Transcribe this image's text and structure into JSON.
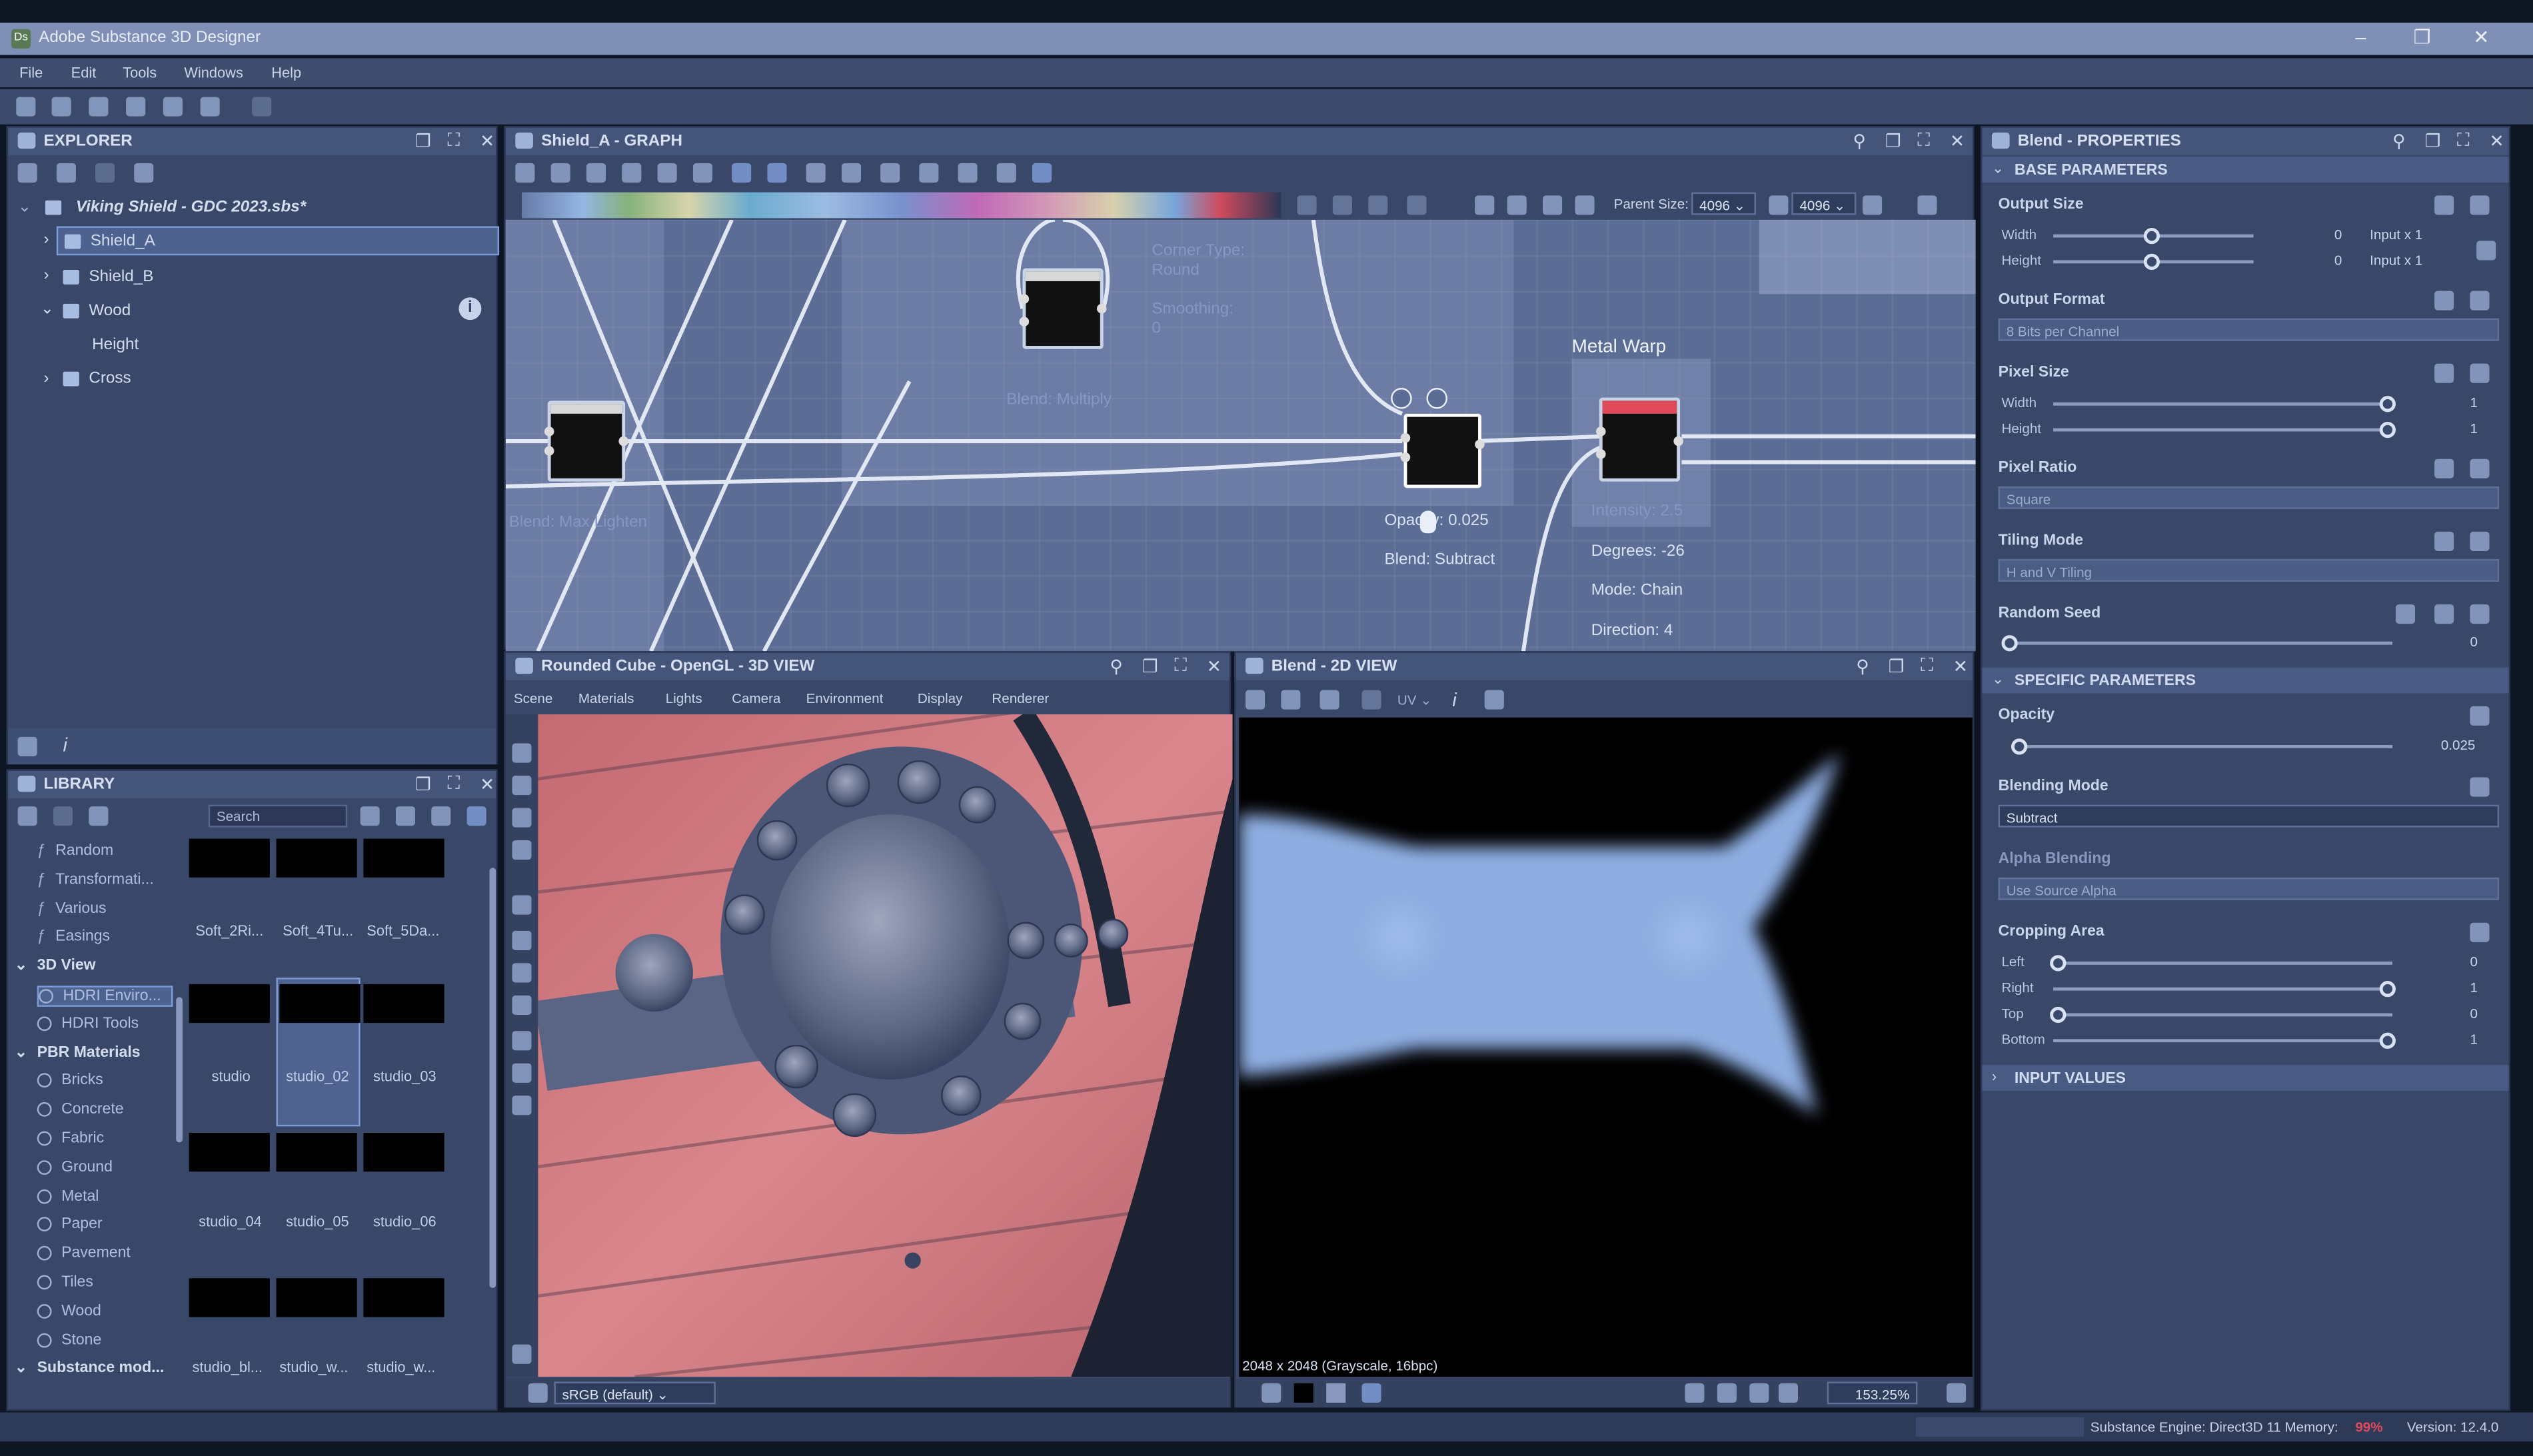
{
  "window": {
    "title": "Adobe Substance 3D Designer",
    "controls": [
      "–",
      "❐",
      "✕"
    ]
  },
  "menu": [
    "File",
    "Edit",
    "Tools",
    "Windows",
    "Help"
  ],
  "explorer": {
    "title": "EXPLORER",
    "package": "Viking Shield - GDC 2023.sbs*",
    "items": [
      "Shield_A",
      "Shield_B",
      "Wood",
      "Height",
      "Cross"
    ]
  },
  "graph": {
    "title": "Shield_A - GRAPH",
    "parent_size_label": "Parent Size:",
    "parent_size": "4096",
    "size2": "4096",
    "nodes": {
      "metal_warp_title": "Metal Warp",
      "corner_type_label": "Corner Type:",
      "corner_type_value": "Round",
      "smoothing_label": "Smoothing:",
      "smoothing_value": "0",
      "blend_multiply": "Blend: Multiply",
      "blend_max_lighten": "Blend: Max Lighten",
      "opacity": "Opacity: 0.025",
      "blend_subtract": "Blend: Subtract",
      "intensity": "Intensity: 2.5",
      "degrees": "Degrees: -26",
      "mode": "Mode: Chain",
      "direction": "Direction: 4"
    }
  },
  "view3d": {
    "title": "Rounded Cube - OpenGL - 3D VIEW",
    "menu": [
      "Scene",
      "Materials",
      "Lights",
      "Camera",
      "Environment",
      "Display",
      "Renderer"
    ],
    "colorspace": "sRGB (default)"
  },
  "view2d": {
    "title": "Blend - 2D VIEW",
    "uv": "UV",
    "info": "2048 x 2048 (Grayscale, 16bpc)",
    "zoom": "153.25%"
  },
  "library": {
    "title": "LIBRARY",
    "search_placeholder": "Search",
    "categories": [
      {
        "label": "Random",
        "type": "fn"
      },
      {
        "label": "Transformati...",
        "type": "fn"
      },
      {
        "label": "Various",
        "type": "fn"
      },
      {
        "label": "Easings",
        "type": "fn"
      },
      {
        "label": "3D View",
        "type": "group"
      },
      {
        "label": "HDRI Enviro...",
        "type": "sel"
      },
      {
        "label": "HDRI Tools",
        "type": "item"
      },
      {
        "label": "PBR Materials",
        "type": "group"
      },
      {
        "label": "Bricks",
        "type": "item"
      },
      {
        "label": "Concrete",
        "type": "item"
      },
      {
        "label": "Fabric",
        "type": "item"
      },
      {
        "label": "Ground",
        "type": "item"
      },
      {
        "label": "Metal",
        "type": "item"
      },
      {
        "label": "Paper",
        "type": "item"
      },
      {
        "label": "Pavement",
        "type": "item"
      },
      {
        "label": "Tiles",
        "type": "item"
      },
      {
        "label": "Wood",
        "type": "item"
      },
      {
        "label": "Stone",
        "type": "item"
      },
      {
        "label": "Substance mod...",
        "type": "group"
      }
    ],
    "thumbnails": [
      "Soft_2Ri...",
      "Soft_4Tu...",
      "Soft_5Da...",
      "studio",
      "studio_02",
      "studio_03",
      "studio_04",
      "studio_05",
      "studio_06",
      "studio_bl...",
      "studio_w...",
      "studio_w..."
    ]
  },
  "properties": {
    "title": "Blend - PROPERTIES",
    "base_header": "BASE PARAMETERS",
    "output_size": {
      "label": "Output Size",
      "width_label": "Width",
      "height_label": "Height",
      "width": "0",
      "height": "0",
      "width_rel": "Input x 1",
      "height_rel": "Input x 1"
    },
    "output_format": {
      "label": "Output Format",
      "value": "8 Bits per Channel"
    },
    "pixel_size": {
      "label": "Pixel Size",
      "width_label": "Width",
      "height_label": "Height",
      "width": "1",
      "height": "1"
    },
    "pixel_ratio": {
      "label": "Pixel Ratio",
      "value": "Square"
    },
    "tiling_mode": {
      "label": "Tiling Mode",
      "value": "H and V Tiling"
    },
    "random_seed": {
      "label": "Random Seed",
      "value": "0"
    },
    "specific_header": "SPECIFIC PARAMETERS",
    "opacity": {
      "label": "Opacity",
      "value": "0.025"
    },
    "blending_mode": {
      "label": "Blending Mode",
      "value": "Subtract"
    },
    "alpha_blending": {
      "label": "Alpha Blending",
      "value": "Use Source Alpha"
    },
    "cropping": {
      "label": "Cropping Area",
      "left_label": "Left",
      "right_label": "Right",
      "top_label": "Top",
      "bottom_label": "Bottom",
      "left": "0",
      "right": "1",
      "top": "0",
      "bottom": "1"
    },
    "input_header": "INPUT VALUES"
  },
  "status": {
    "engine": "Substance Engine: Direct3D 11  Memory:",
    "memory": "99%",
    "version": "Version: 12.4.0"
  },
  "colors": {
    "accent": "#7d9bd6",
    "graph_bg": "#5b6c95",
    "panel": "#394869",
    "red_tab": "#e04b5c"
  }
}
